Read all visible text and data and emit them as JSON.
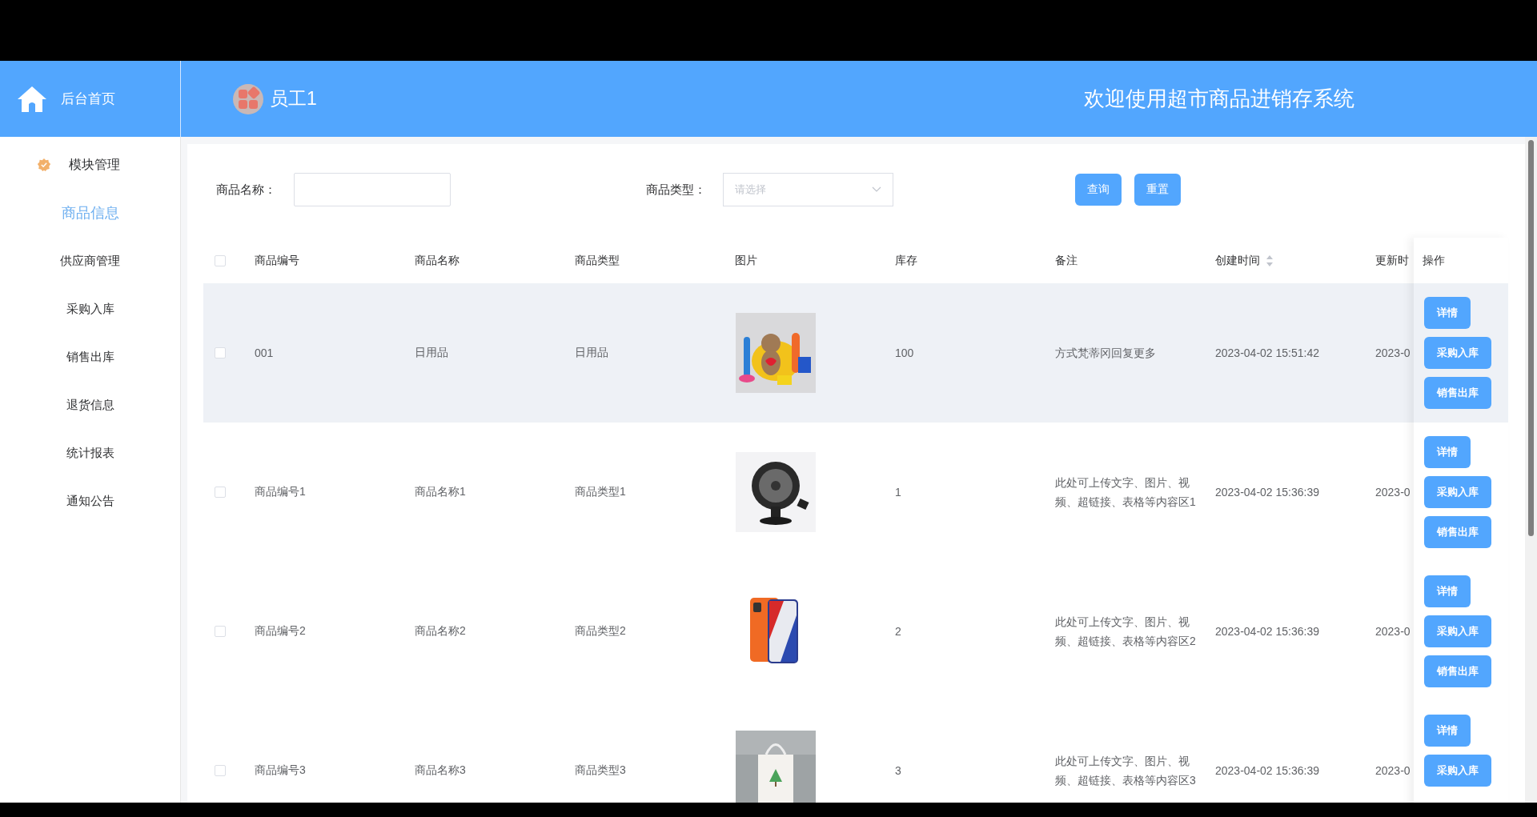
{
  "sidebar": {
    "home_label": "后台首页",
    "group_label": "模块管理",
    "items": [
      {
        "label": "商品信息",
        "selected": true
      },
      {
        "label": "供应商管理",
        "selected": false
      },
      {
        "label": "采购入库",
        "selected": false
      },
      {
        "label": "销售出库",
        "selected": false
      },
      {
        "label": "退货信息",
        "selected": false
      },
      {
        "label": "统计报表",
        "selected": false
      },
      {
        "label": "通知公告",
        "selected": false
      }
    ]
  },
  "header": {
    "user": "员工1",
    "title": "欢迎使用超市商品进销存系统"
  },
  "filters": {
    "name_label": "商品名称：",
    "type_label": "商品类型：",
    "type_placeholder": "请选择",
    "buttons": [
      "查询",
      "重置"
    ]
  },
  "table": {
    "all_checked": false,
    "action_label": "操作",
    "columns": [
      {
        "label": "商品编号",
        "sortable": false
      },
      {
        "label": "商品名称",
        "sortable": false
      },
      {
        "label": "商品类型",
        "sortable": false
      },
      {
        "label": "图片",
        "sortable": false
      },
      {
        "label": "库存",
        "sortable": false
      },
      {
        "label": "备注",
        "sortable": false
      },
      {
        "label": "创建时间",
        "sortable": true
      },
      {
        "label": "更新时",
        "sortable": false
      }
    ],
    "rows": [
      {
        "checked": false,
        "highlighted": true,
        "cells": [
          {
            "kind": "text",
            "text": "001"
          },
          {
            "kind": "text",
            "text": "日用品"
          },
          {
            "kind": "text",
            "text": "日用品"
          },
          {
            "kind": "picture"
          },
          {
            "kind": "text",
            "text": "100"
          },
          {
            "kind": "note",
            "text": "方式梵蒂冈回复更多"
          },
          {
            "kind": "text",
            "text": "2023-04-02 15:51:42"
          },
          {
            "kind": "text",
            "text": "2023-0"
          }
        ],
        "actions": [
          "详情",
          "采购入库",
          "销售出库"
        ]
      },
      {
        "checked": false,
        "highlighted": false,
        "cells": [
          {
            "kind": "text",
            "text": "商品编号1"
          },
          {
            "kind": "text",
            "text": "商品名称1"
          },
          {
            "kind": "text",
            "text": "商品类型1"
          },
          {
            "kind": "picture"
          },
          {
            "kind": "text",
            "text": "1"
          },
          {
            "kind": "note",
            "text": "此处可上传文字、图片、视频、超链接、表格等内容区1"
          },
          {
            "kind": "text",
            "text": "2023-04-02 15:36:39"
          },
          {
            "kind": "text",
            "text": "2023-0"
          }
        ],
        "actions": [
          "详情",
          "采购入库",
          "销售出库"
        ]
      },
      {
        "checked": false,
        "highlighted": false,
        "cells": [
          {
            "kind": "text",
            "text": "商品编号2"
          },
          {
            "kind": "text",
            "text": "商品名称2"
          },
          {
            "kind": "text",
            "text": "商品类型2"
          },
          {
            "kind": "picture"
          },
          {
            "kind": "text",
            "text": "2"
          },
          {
            "kind": "note",
            "text": "此处可上传文字、图片、视频、超链接、表格等内容区2"
          },
          {
            "kind": "text",
            "text": "2023-04-02 15:36:39"
          },
          {
            "kind": "text",
            "text": "2023-0"
          }
        ],
        "actions": [
          "详情",
          "采购入库",
          "销售出库"
        ]
      },
      {
        "checked": false,
        "highlighted": false,
        "cells": [
          {
            "kind": "text",
            "text": "商品编号3"
          },
          {
            "kind": "text",
            "text": "商品名称3"
          },
          {
            "kind": "text",
            "text": "商品类型3"
          },
          {
            "kind": "picture"
          },
          {
            "kind": "text",
            "text": "3"
          },
          {
            "kind": "note",
            "text": "此处可上传文字、图片、视频、超链接、表格等内容区3"
          },
          {
            "kind": "text",
            "text": "2023-04-02 15:36:39"
          },
          {
            "kind": "text",
            "text": "2023-0"
          }
        ],
        "actions": [
          "详情",
          "采购入库"
        ]
      }
    ]
  }
}
